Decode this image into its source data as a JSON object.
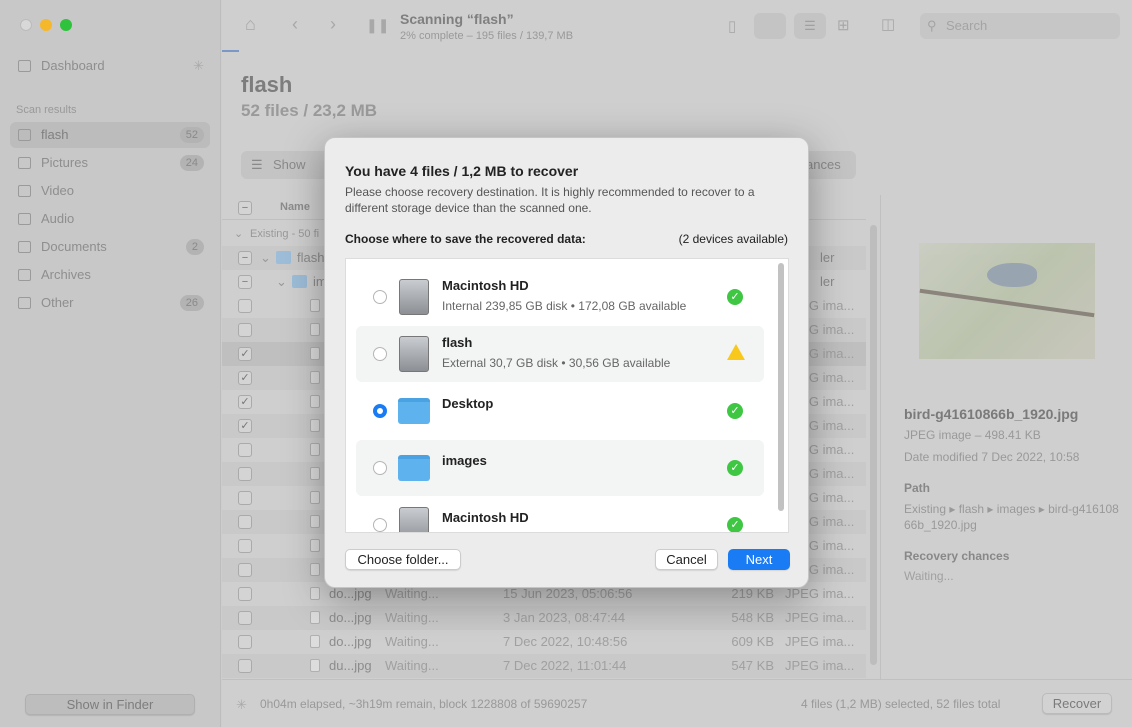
{
  "window": {
    "title": "Scanning “flash”",
    "subtitle": "2% complete – 195 files / 139,7 MB",
    "search_placeholder": "Search"
  },
  "sidebar": {
    "dashboard": "Dashboard",
    "section": "Scan results",
    "items": [
      {
        "label": "flash",
        "count": "52"
      },
      {
        "label": "Pictures",
        "count": "24"
      },
      {
        "label": "Video",
        "count": ""
      },
      {
        "label": "Audio",
        "count": ""
      },
      {
        "label": "Documents",
        "count": "2"
      },
      {
        "label": "Archives",
        "count": ""
      },
      {
        "label": "Other",
        "count": "26"
      }
    ],
    "show_in_finder": "Show in Finder"
  },
  "main": {
    "title": "flash",
    "subtitle": "52 files / 23,2 MB",
    "show_label": "Show",
    "chances_label": "ances",
    "name_header": "Name",
    "group_label": "Existing - 50 fi",
    "folders": [
      {
        "name": "flash",
        "kind": "ler"
      },
      {
        "name": "im",
        "kind": "ler"
      }
    ],
    "rows": [
      {
        "checked": false,
        "name": "",
        "status": "",
        "date": "",
        "size": "",
        "kind": "JPEG ima..."
      },
      {
        "checked": false,
        "name": "",
        "status": "",
        "date": "",
        "size": "",
        "kind": "JPEG ima..."
      },
      {
        "checked": true,
        "name": "",
        "status": "",
        "date": "",
        "size": "",
        "kind": "JPEG ima..."
      },
      {
        "checked": true,
        "name": "",
        "status": "",
        "date": "",
        "size": "",
        "kind": "JPEG ima..."
      },
      {
        "checked": true,
        "name": "",
        "status": "",
        "date": "",
        "size": "",
        "kind": "JPEG ima..."
      },
      {
        "checked": true,
        "name": "",
        "status": "",
        "date": "",
        "size": "",
        "kind": "JPEG ima..."
      },
      {
        "checked": false,
        "name": "",
        "status": "",
        "date": "",
        "size": "",
        "kind": "JPEG ima..."
      },
      {
        "checked": false,
        "name": "",
        "status": "",
        "date": "",
        "size": "",
        "kind": "JPEG ima..."
      },
      {
        "checked": false,
        "name": "",
        "status": "",
        "date": "",
        "size": "",
        "kind": "JPEG ima..."
      },
      {
        "checked": false,
        "name": "",
        "status": "",
        "date": "",
        "size": "",
        "kind": "JPEG ima..."
      },
      {
        "checked": false,
        "name": "",
        "status": "",
        "date": "",
        "size": "",
        "kind": "JPEG ima..."
      },
      {
        "checked": false,
        "name": "",
        "status": "",
        "date": "",
        "size": "",
        "kind": "JPEG ima..."
      },
      {
        "checked": false,
        "name": "do...jpg",
        "status": "Waiting...",
        "date": "15 Jun 2023, 05:06:56",
        "size": "219 KB",
        "kind": "JPEG ima..."
      },
      {
        "checked": false,
        "name": "do...jpg",
        "status": "Waiting...",
        "date": "3 Jan 2023, 08:47:44",
        "size": "548 KB",
        "kind": "JPEG ima..."
      },
      {
        "checked": false,
        "name": "do...jpg",
        "status": "Waiting...",
        "date": "7 Dec 2022, 10:48:56",
        "size": "609 KB",
        "kind": "JPEG ima..."
      },
      {
        "checked": false,
        "name": "du...jpg",
        "status": "Waiting...",
        "date": "7 Dec 2022, 11:01:44",
        "size": "547 KB",
        "kind": "JPEG ima..."
      }
    ]
  },
  "preview": {
    "filename": "bird-g41610866b_1920.jpg",
    "type": "JPEG image – 498.41 KB",
    "date_label": "Date modified",
    "date": "7 Dec 2022, 10:58",
    "path_label": "Path",
    "path": "Existing ▸ flash ▸ images ▸ bird-g41610866b_1920.jpg",
    "chances_label": "Recovery chances",
    "chances": "Waiting..."
  },
  "status": {
    "elapsed": "0h04m elapsed, ~3h19m remain, block 1228808 of 59690257",
    "selection": "4 files (1,2 MB) selected, 52 files total",
    "recover": "Recover"
  },
  "dialog": {
    "title": "You have 4 files / 1,2 MB to recover",
    "description": "Please choose recovery destination. It is highly recommended to recover to a different storage device than the scanned one.",
    "choose_label": "Choose where to save the recovered data:",
    "devices": "(2 devices available)",
    "items": [
      {
        "name": "Macintosh HD",
        "detail": "Internal 239,85 GB disk • 172,08 GB available",
        "icon": "internal-disk",
        "status": "ok",
        "selected": false
      },
      {
        "name": "flash",
        "detail": "External 30,7 GB disk • 30,56 GB available",
        "icon": "external-disk",
        "status": "warning",
        "selected": false
      },
      {
        "name": "Desktop",
        "detail": "",
        "icon": "desktop-folder",
        "status": "ok",
        "selected": true
      },
      {
        "name": "images",
        "detail": "",
        "icon": "folder",
        "status": "ok",
        "selected": false
      },
      {
        "name": "Macintosh HD",
        "detail": "",
        "icon": "internal-disk",
        "status": "ok",
        "selected": false
      }
    ],
    "choose_folder": "Choose folder...",
    "cancel": "Cancel",
    "next": "Next"
  },
  "colors": {
    "accent": "#1a7cf5",
    "ok": "#3fc744",
    "warning": "#f8c91c"
  }
}
